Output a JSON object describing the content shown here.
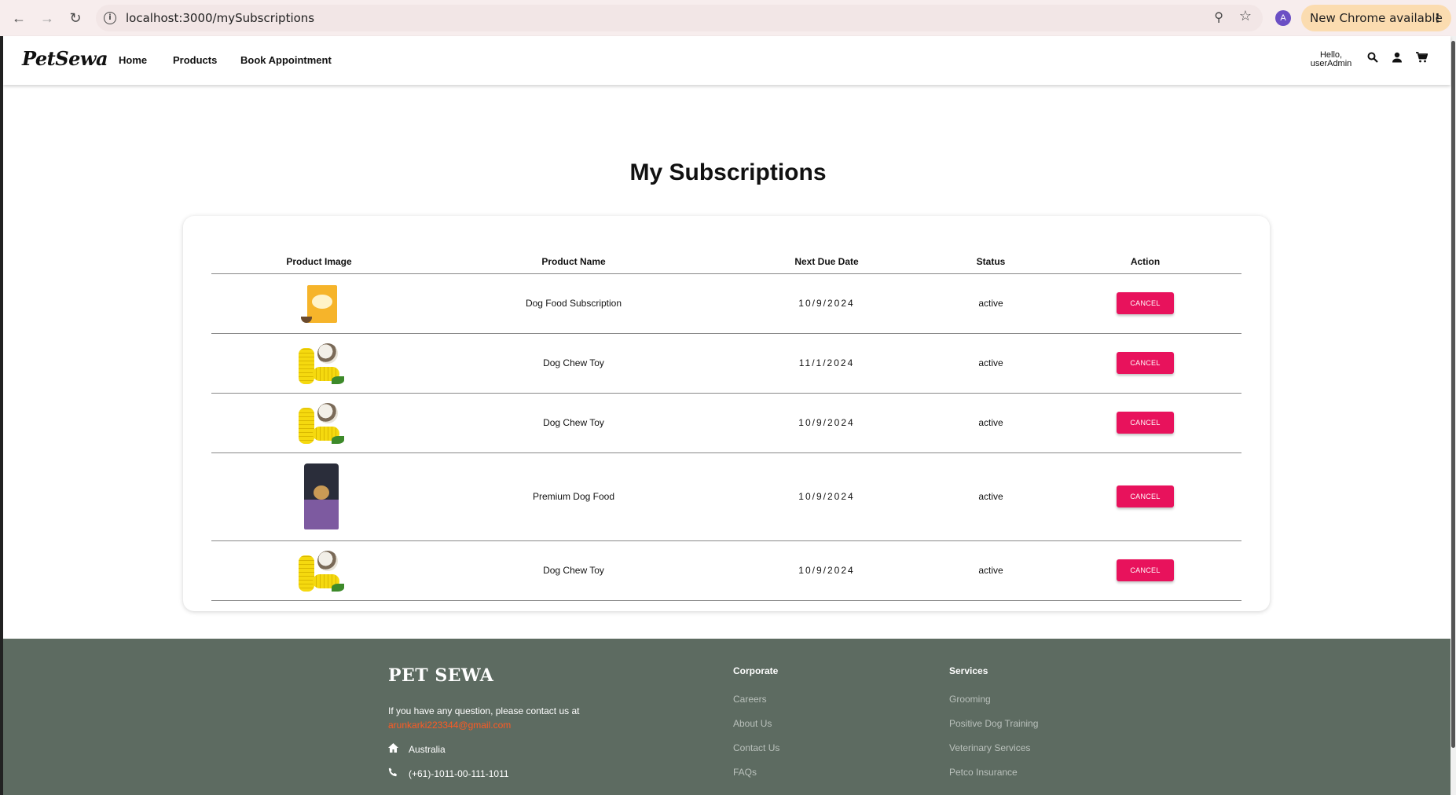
{
  "browser": {
    "url": "localhost:3000/mySubscriptions",
    "profile_initial": "A",
    "update_label": "New Chrome available"
  },
  "header": {
    "logo": "PetSewa",
    "nav": [
      "Home",
      "Products",
      "Book Appointment"
    ],
    "greeting_line1": "Hello,",
    "greeting_line2": "userAdmin"
  },
  "main": {
    "title": "My Subscriptions",
    "columns": [
      "Product Image",
      "Product Name",
      "Next Due Date",
      "Status",
      "Action"
    ],
    "rows": [
      {
        "image": "dog-food-box",
        "name": "Dog Food Subscription",
        "due": "10/9/2024",
        "status": "active",
        "action": "CANCEL"
      },
      {
        "image": "dog-chew-toy",
        "name": "Dog Chew Toy",
        "due": "11/1/2024",
        "status": "active",
        "action": "CANCEL"
      },
      {
        "image": "dog-chew-toy",
        "name": "Dog Chew Toy",
        "due": "10/9/2024",
        "status": "active",
        "action": "CANCEL"
      },
      {
        "image": "premium-dog-food-bag",
        "name": "Premium Dog Food",
        "due": "10/9/2024",
        "status": "active",
        "action": "CANCEL"
      },
      {
        "image": "dog-chew-toy",
        "name": "Dog Chew Toy",
        "due": "10/9/2024",
        "status": "active",
        "action": "CANCEL"
      }
    ]
  },
  "footer": {
    "logo": "PET SEWA",
    "contact_text": "If you have any question, please contact us at",
    "email": "arunkarki223344@gmail.com",
    "location": "Australia",
    "phone": "(+61)-1011-00-111-1011",
    "corporate": {
      "heading": "Corporate",
      "links": [
        "Careers",
        "About Us",
        "Contact Us",
        "FAQs"
      ]
    },
    "services": {
      "heading": "Services",
      "links": [
        "Grooming",
        "Positive Dog Training",
        "Veterinary Services",
        "Petco Insurance"
      ]
    }
  },
  "colors": {
    "accent": "#e8125c",
    "due_date": "#e0231f",
    "status_active": "#1e9a1e",
    "footer_bg": "#5d6b61",
    "footer_email": "#ff5a22"
  }
}
